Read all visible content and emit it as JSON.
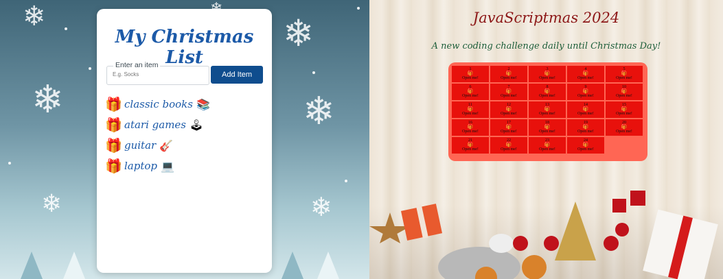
{
  "list_card": {
    "title": "My Christmas List",
    "input_label": "Enter an item",
    "input_placeholder": "E.g. Socks",
    "add_button": "Add Item",
    "items": [
      {
        "text": "classic books",
        "emoji": "📚"
      },
      {
        "text": "atari games",
        "emoji": "🕹"
      },
      {
        "text": "guitar",
        "emoji": "🎸"
      },
      {
        "text": "laptop",
        "emoji": "💻"
      }
    ],
    "gift_icon": "🎁"
  },
  "calendar": {
    "title": "JavaScriptmas 2024",
    "subtitle": "A new coding challenge daily until Christmas Day!",
    "open_label": "Open me!",
    "gift_glyph": "🎁",
    "days": [
      "1",
      "2",
      "3",
      "4",
      "5",
      "6",
      "7",
      "8",
      "9",
      "10",
      "11",
      "12",
      "13",
      "14",
      "15",
      "16",
      "17",
      "18",
      "19",
      "20",
      "21",
      "22",
      "23",
      "24"
    ]
  },
  "colors": {
    "accent_blue": "#1c5aa8",
    "button_blue": "#0f4d8e",
    "calendar_bg": "#ff6654",
    "cell_red": "#e8110c",
    "title_red": "#8c1717",
    "subtitle_green": "#1e5e3a"
  }
}
